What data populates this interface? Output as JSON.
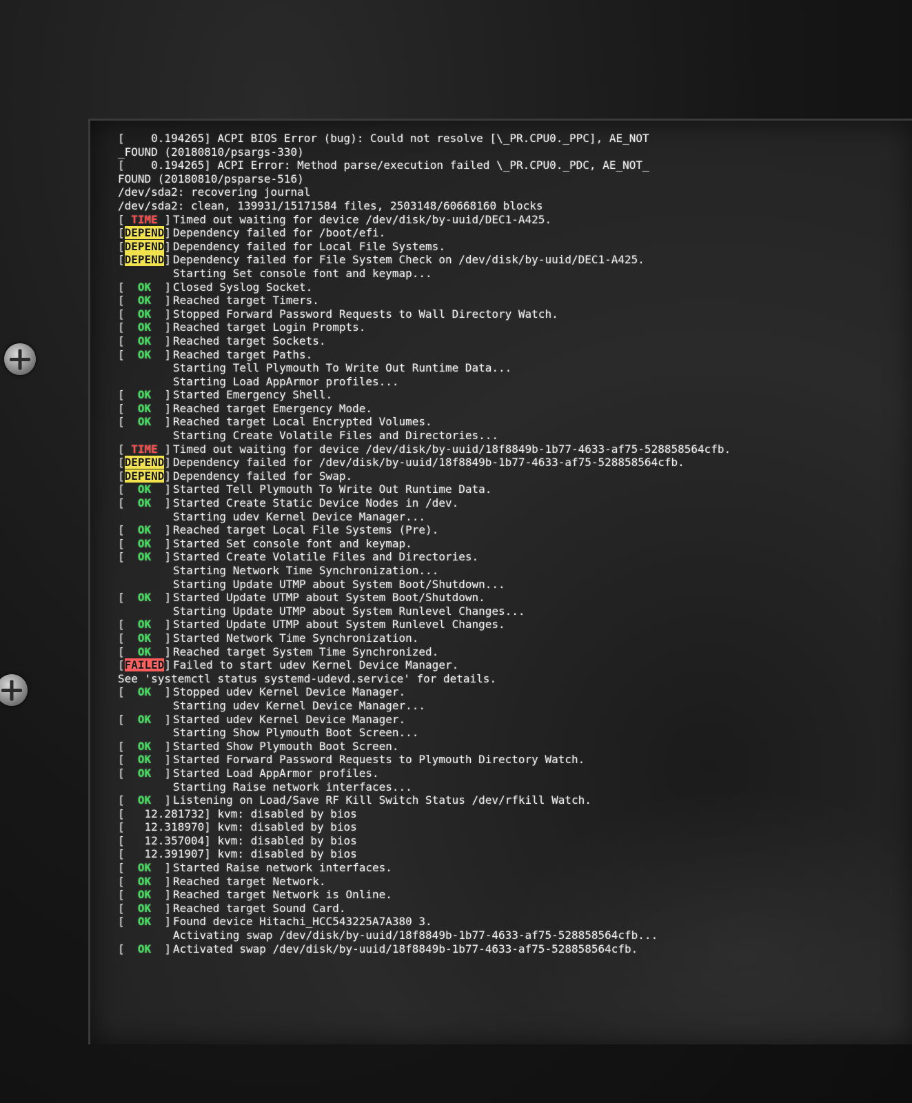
{
  "console_lines": [
    {
      "status": "",
      "text": "[    0.194265] ACPI BIOS Error (bug): Could not resolve [\\_PR.CPU0._PPC], AE_NOT"
    },
    {
      "status": "",
      "text": "_FOUND (20180810/psargs-330)"
    },
    {
      "status": "",
      "text": "[    0.194265] ACPI Error: Method parse/execution failed \\_PR.CPU0._PDC, AE_NOT_"
    },
    {
      "status": "",
      "text": "FOUND (20180810/psparse-516)"
    },
    {
      "status": "",
      "text": "/dev/sda2: recovering journal"
    },
    {
      "status": "",
      "text": "/dev/sda2: clean, 139931/15171584 files, 2503148/60668160 blocks"
    },
    {
      "status": "TIME",
      "text": "Timed out waiting for device /dev/disk/by-uuid/DEC1-A425."
    },
    {
      "status": "DEPEND",
      "text": "Dependency failed for /boot/efi."
    },
    {
      "status": "DEPEND",
      "text": "Dependency failed for Local File Systems."
    },
    {
      "status": "DEPEND",
      "text": "Dependency failed for File System Check on /dev/disk/by-uuid/DEC1-A425."
    },
    {
      "status": "indent",
      "text": "Starting Set console font and keymap..."
    },
    {
      "status": "OK",
      "text": "Closed Syslog Socket."
    },
    {
      "status": "OK",
      "text": "Reached target Timers."
    },
    {
      "status": "OK",
      "text": "Stopped Forward Password Requests to Wall Directory Watch."
    },
    {
      "status": "OK",
      "text": "Reached target Login Prompts."
    },
    {
      "status": "OK",
      "text": "Reached target Sockets."
    },
    {
      "status": "OK",
      "text": "Reached target Paths."
    },
    {
      "status": "indent",
      "text": "Starting Tell Plymouth To Write Out Runtime Data..."
    },
    {
      "status": "indent",
      "text": "Starting Load AppArmor profiles..."
    },
    {
      "status": "OK",
      "text": "Started Emergency Shell."
    },
    {
      "status": "OK",
      "text": "Reached target Emergency Mode."
    },
    {
      "status": "OK",
      "text": "Reached target Local Encrypted Volumes."
    },
    {
      "status": "indent",
      "text": "Starting Create Volatile Files and Directories..."
    },
    {
      "status": "TIME",
      "text": "Timed out waiting for device /dev/disk/by-uuid/18f8849b-1b77-4633-af75-528858564cfb."
    },
    {
      "status": "DEPEND",
      "text": "Dependency failed for /dev/disk/by-uuid/18f8849b-1b77-4633-af75-528858564cfb."
    },
    {
      "status": "DEPEND",
      "text": "Dependency failed for Swap."
    },
    {
      "status": "OK",
      "text": "Started Tell Plymouth To Write Out Runtime Data."
    },
    {
      "status": "OK",
      "text": "Started Create Static Device Nodes in /dev."
    },
    {
      "status": "indent",
      "text": "Starting udev Kernel Device Manager..."
    },
    {
      "status": "OK",
      "text": "Reached target Local File Systems (Pre)."
    },
    {
      "status": "OK",
      "text": "Started Set console font and keymap."
    },
    {
      "status": "OK",
      "text": "Started Create Volatile Files and Directories."
    },
    {
      "status": "indent",
      "text": "Starting Network Time Synchronization..."
    },
    {
      "status": "indent",
      "text": "Starting Update UTMP about System Boot/Shutdown..."
    },
    {
      "status": "OK",
      "text": "Started Update UTMP about System Boot/Shutdown."
    },
    {
      "status": "indent",
      "text": "Starting Update UTMP about System Runlevel Changes..."
    },
    {
      "status": "OK",
      "text": "Started Update UTMP about System Runlevel Changes."
    },
    {
      "status": "OK",
      "text": "Started Network Time Synchronization."
    },
    {
      "status": "OK",
      "text": "Reached target System Time Synchronized."
    },
    {
      "status": "FAILED",
      "text": "Failed to start udev Kernel Device Manager."
    },
    {
      "status": "",
      "text": "See 'systemctl status systemd-udevd.service' for details."
    },
    {
      "status": "OK",
      "text": "Stopped udev Kernel Device Manager."
    },
    {
      "status": "indent",
      "text": "Starting udev Kernel Device Manager..."
    },
    {
      "status": "OK",
      "text": "Started udev Kernel Device Manager."
    },
    {
      "status": "indent",
      "text": "Starting Show Plymouth Boot Screen..."
    },
    {
      "status": "OK",
      "text": "Started Show Plymouth Boot Screen."
    },
    {
      "status": "OK",
      "text": "Started Forward Password Requests to Plymouth Directory Watch."
    },
    {
      "status": "OK",
      "text": "Started Load AppArmor profiles."
    },
    {
      "status": "indent",
      "text": "Starting Raise network interfaces..."
    },
    {
      "status": "OK",
      "text": "Listening on Load/Save RF Kill Switch Status /dev/rfkill Watch."
    },
    {
      "status": "",
      "text": "[   12.281732] kvm: disabled by bios"
    },
    {
      "status": "",
      "text": "[   12.318970] kvm: disabled by bios"
    },
    {
      "status": "",
      "text": "[   12.357004] kvm: disabled by bios"
    },
    {
      "status": "",
      "text": "[   12.391907] kvm: disabled by bios"
    },
    {
      "status": "OK",
      "text": "Started Raise network interfaces."
    },
    {
      "status": "OK",
      "text": "Reached target Network."
    },
    {
      "status": "OK",
      "text": "Reached target Network is Online."
    },
    {
      "status": "OK",
      "text": "Reached target Sound Card."
    },
    {
      "status": "OK",
      "text": "Found device Hitachi_HCC543225A7A380 3."
    },
    {
      "status": "indent",
      "text": "Activating swap /dev/disk/by-uuid/18f8849b-1b77-4633-af75-528858564cfb..."
    },
    {
      "status": "OK",
      "text": "Activated swap /dev/disk/by-uuid/18f8849b-1b77-4633-af75-528858564cfb."
    }
  ],
  "status_labels": {
    "OK": "  OK  ",
    "TIME": " TIME ",
    "DEPEND": "DEPEND",
    "FAILED": "FAILED"
  },
  "colors": {
    "ok": "#3ee05a",
    "time": "#ff4a4a",
    "depend_bg": "#f2e24a",
    "failed": "#ff4a4a",
    "text": "#ececec"
  }
}
